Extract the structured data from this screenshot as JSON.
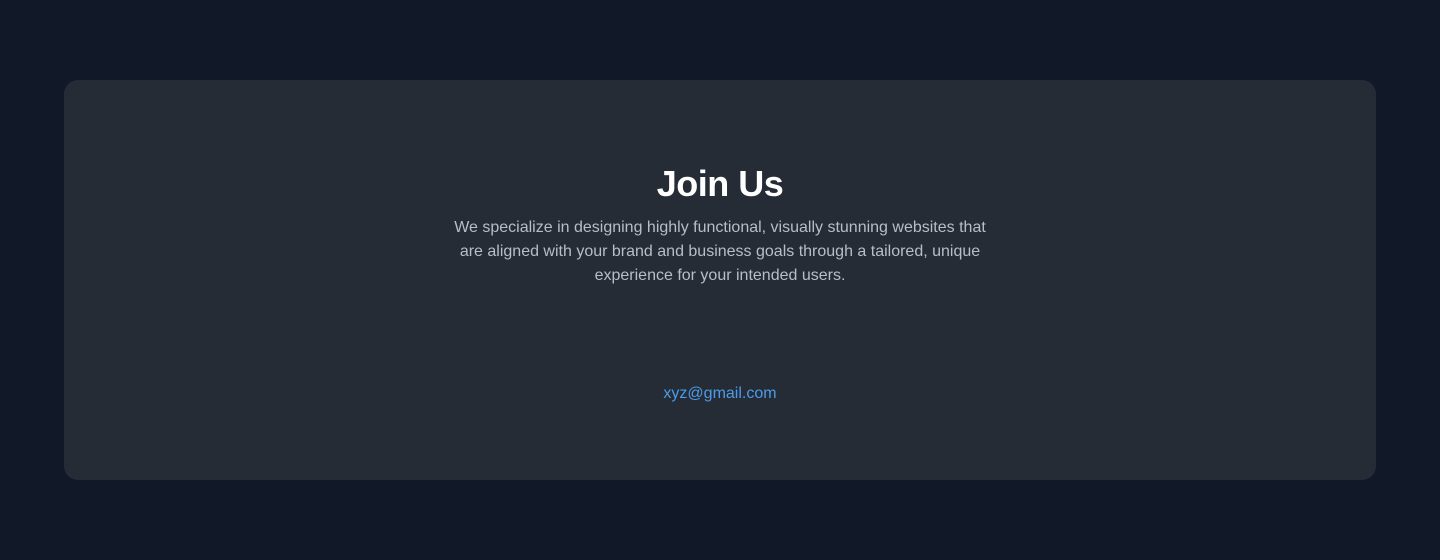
{
  "join_section": {
    "title": "Join Us",
    "description": "We specialize in designing highly functional, visually stunning websites that are aligned with your brand and business goals through a tailored, unique experience for your intended users.",
    "email": "xyz@gmail.com"
  },
  "colors": {
    "page_background": "#111827",
    "card_background": "#252c35",
    "title_text": "#ffffff",
    "body_text": "#b8bec8",
    "link_text": "#4b9cec"
  }
}
